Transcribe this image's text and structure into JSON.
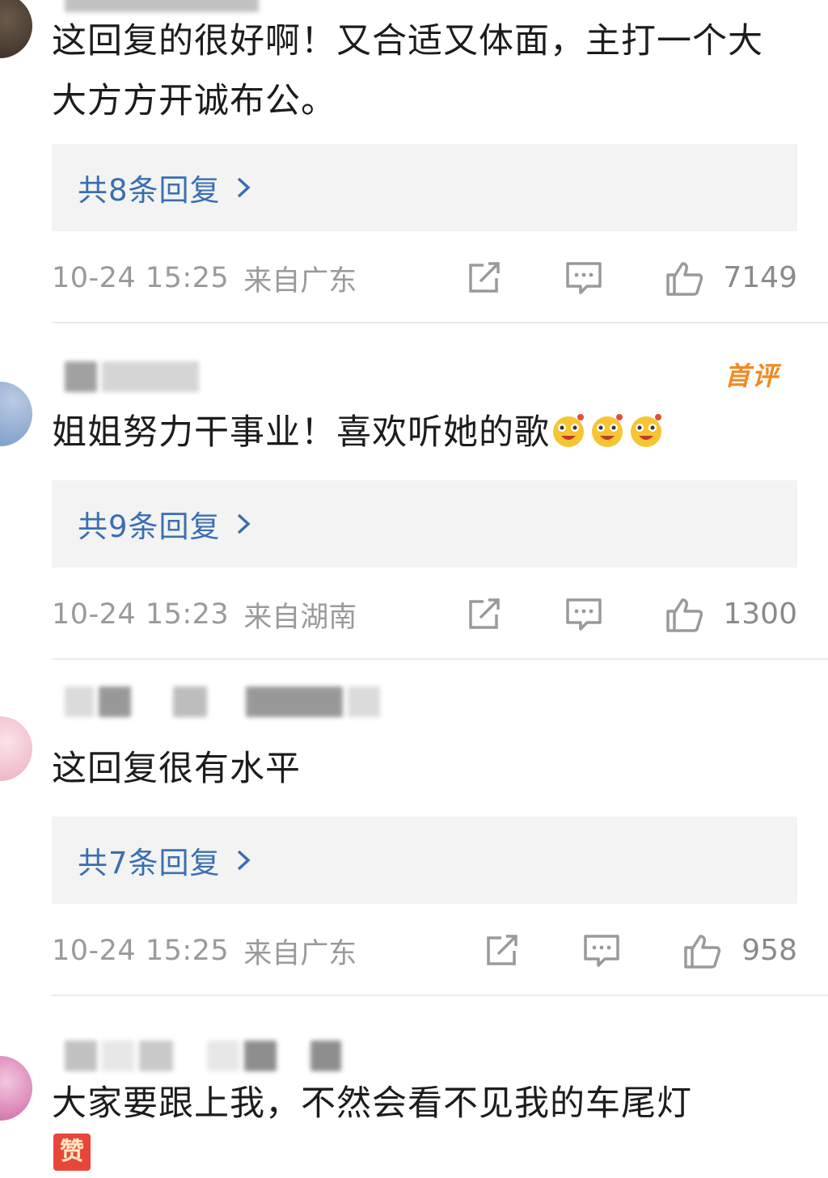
{
  "comments": [
    {
      "text": "这回复的很好啊！又合适又体面，主打一个大大方方开诚布公。",
      "replies_label": "共8条回复",
      "time": "10-24 15:25",
      "location": "来自广东",
      "likes": "7149"
    },
    {
      "badge": "首评",
      "text": "姐姐努力干事业！喜欢听她的歌",
      "replies_label": "共9条回复",
      "time": "10-24 15:23",
      "location": "来自湖南",
      "likes": "1300"
    },
    {
      "text": "这回复很有水平",
      "replies_label": "共7条回复",
      "time": "10-24 15:25",
      "location": "来自广东",
      "likes": "958"
    },
    {
      "text": "大家要跟上我，不然会看不见我的车尾灯"
    }
  ],
  "zan_char": "赞",
  "colors": {
    "reply_link": "#3a6fb0",
    "meta_gray": "#9a9a9a",
    "badge_orange": "#f08a24",
    "reply_bg": "#f3f3f3"
  },
  "icons": [
    "share-icon",
    "comment-icon",
    "like-icon",
    "chevron-right-icon",
    "laughing-emoji-icon",
    "zan-sticker-icon"
  ]
}
